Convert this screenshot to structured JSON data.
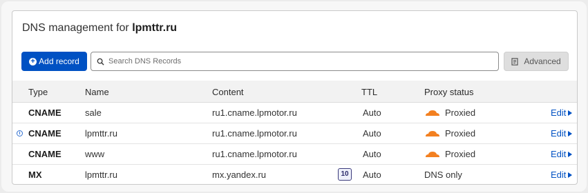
{
  "header": {
    "title_prefix": "DNS management for",
    "domain": "lpmttr.ru"
  },
  "toolbar": {
    "add_label": "Add record",
    "search_placeholder": "Search DNS Records",
    "advanced_label": "Advanced"
  },
  "table": {
    "columns": [
      "Type",
      "Name",
      "Content",
      "TTL",
      "Proxy status"
    ],
    "rows": [
      {
        "type": "CNAME",
        "name": "sale",
        "content": "ru1.cname.lpmotor.ru",
        "ttl": "Auto",
        "proxy": "Proxied",
        "edit": "Edit"
      },
      {
        "type": "CNAME",
        "name": "lpmttr.ru",
        "content": "ru1.cname.lpmotor.ru",
        "ttl": "Auto",
        "proxy": "Proxied",
        "edit": "Edit"
      },
      {
        "type": "CNAME",
        "name": "www",
        "content": "ru1.cname.lpmotor.ru",
        "ttl": "Auto",
        "proxy": "Proxied",
        "edit": "Edit"
      },
      {
        "type": "MX",
        "name": "lpmttr.ru",
        "content": "mx.yandex.ru",
        "priority": "10",
        "ttl": "Auto",
        "proxy": "DNS only",
        "edit": "Edit"
      }
    ]
  },
  "colors": {
    "accent": "#0051c3",
    "cloud": "#f38020"
  },
  "icons": {
    "add": "plus-circle-icon",
    "search": "search-icon",
    "advanced": "document-icon",
    "proxied": "cloud-icon",
    "info": "info-icon",
    "edit": "caret-right-icon"
  }
}
